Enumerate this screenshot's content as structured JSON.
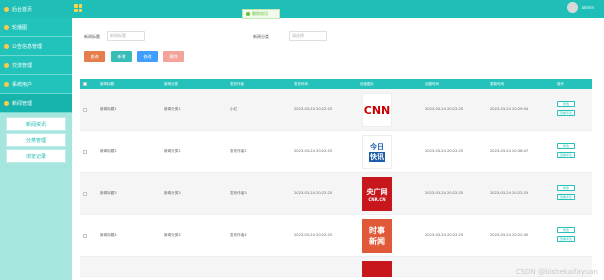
{
  "sidebar": {
    "header": "后台首页",
    "items": [
      {
        "label": "轮播图"
      },
      {
        "label": "公告信息管理"
      },
      {
        "label": "交流管理"
      },
      {
        "label": "系统用户"
      },
      {
        "label": "新闻管理"
      }
    ],
    "subitems": [
      {
        "label": "新闻资讯"
      },
      {
        "label": "分类管理"
      },
      {
        "label": "浏览记录"
      }
    ]
  },
  "topbar": {
    "toast": "删除成功",
    "user": "admin"
  },
  "search": {
    "label1": "新闻标题",
    "input1_placeholder": "新闻标题",
    "label2": "新闻分类",
    "input2_placeholder": "请选择"
  },
  "buttons": {
    "query": "查询",
    "add": "新增",
    "edit": "修改",
    "delete": "删除"
  },
  "colors": {
    "primary": "#25c2bb",
    "query": "#e57d4d",
    "add": "#38bcb6",
    "edit": "#409eff",
    "delete": "#f3a39a"
  },
  "table": {
    "headers": [
      "新闻标题",
      "新闻分类",
      "发布作者",
      "发布时间",
      "封面图片",
      "创建时间",
      "更新时间",
      "操作"
    ],
    "rows": [
      {
        "title": "新闻标题1",
        "category": "新闻分类1",
        "author": "小红",
        "publish": "2023-03-24 20:22:25",
        "img_top": "CNN",
        "img_bottom": "",
        "created": "2023-03-24 20:22:25",
        "updated": "2023-03-24 20:29:54"
      },
      {
        "title": "新闻标题2",
        "category": "新闻分类2",
        "author": "发布作者2",
        "publish": "2023-03-24 20:22:25",
        "img_top": "今日",
        "img_bottom": "快讯",
        "created": "2023-03-24 20:22:25",
        "updated": "2023-03-24 20:36:47"
      },
      {
        "title": "新闻标题3",
        "category": "新闻分类3",
        "author": "发布作者3",
        "publish": "2023-03-24 20:22:25",
        "img_top": "央广网",
        "img_bottom": "CNR.CN",
        "created": "2023-03-24 20:22:25",
        "updated": "2023-03-24 20:22:25"
      },
      {
        "title": "新闻标题4",
        "category": "新闻分类4",
        "author": "发布作者4",
        "publish": "2023-03-24 20:22:25",
        "img_top": "时事",
        "img_bottom": "新闻",
        "created": "2023-03-24 20:22:25",
        "updated": "2023-03-24 20:22:40"
      }
    ],
    "action_edit": "修改",
    "action_detail": "查看评论"
  },
  "watermark": "CSDN @bishekaifayuan"
}
